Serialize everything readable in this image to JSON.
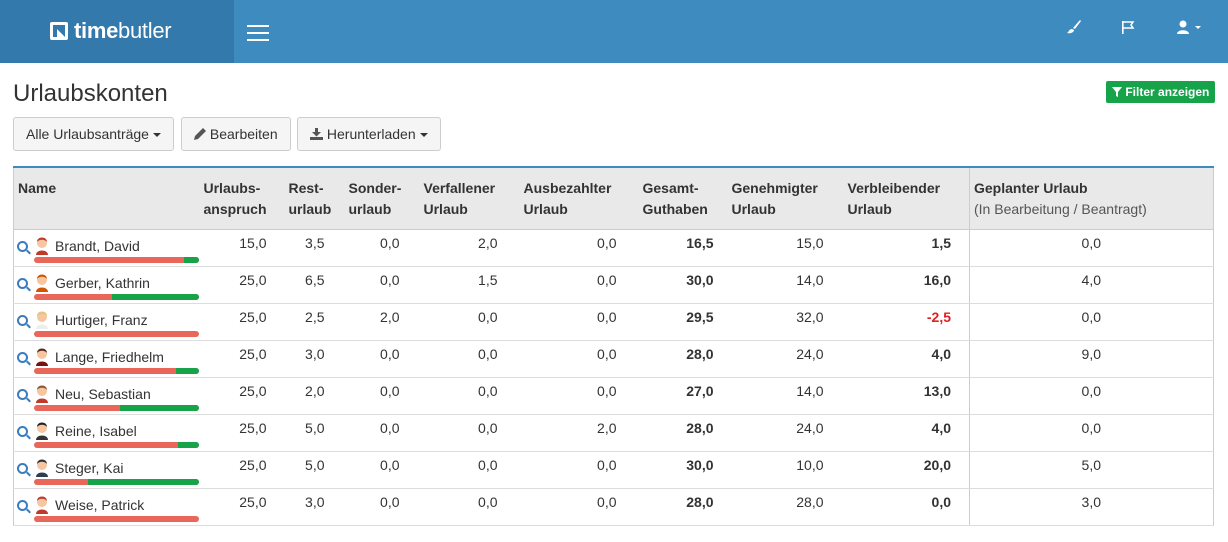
{
  "header": {
    "brand_bold": "time",
    "brand_rest": "butler"
  },
  "page": {
    "title": "Urlaubskonten",
    "filter_button": "Filter anzeigen"
  },
  "toolbar": {
    "requests": "Alle Urlaubsanträge",
    "edit": "Bearbeiten",
    "download": "Herunterladen"
  },
  "colors": {
    "navbar": "#3e8bc0",
    "brand": "#3379ac",
    "filter_button": "#17a34a",
    "bar_used": "#e8675a",
    "bar_remaining": "#17a34a",
    "negative": "#e02020"
  },
  "table": {
    "headers": [
      [
        "Name",
        ""
      ],
      [
        "Urlaubs-",
        "anspruch"
      ],
      [
        "Rest-",
        "urlaub"
      ],
      [
        "Sonder-",
        "urlaub"
      ],
      [
        "Verfallener",
        "Urlaub"
      ],
      [
        "Ausbezahlter",
        "Urlaub"
      ],
      [
        "Gesamt-",
        "Guthaben"
      ],
      [
        "Genehmigter",
        "Urlaub"
      ],
      [
        "Verbleibender",
        "Urlaub"
      ],
      [
        "Geplanter Urlaub",
        "(In Bearbeitung / Beantragt)"
      ]
    ],
    "rows": [
      {
        "name": "Brandt, David",
        "avatar": "person-male-redhair-icon",
        "values": [
          "15,0",
          "3,5",
          "0,0",
          "2,0",
          "0,0",
          "16,5",
          "15,0",
          "1,5",
          "0,0"
        ],
        "remaining_fraction": 0.09,
        "negative": false
      },
      {
        "name": "Gerber, Kathrin",
        "avatar": "person-female-redhair-icon",
        "values": [
          "25,0",
          "6,5",
          "0,0",
          "1,5",
          "0,0",
          "30,0",
          "14,0",
          "16,0",
          "4,0"
        ],
        "remaining_fraction": 0.53,
        "negative": false
      },
      {
        "name": "Hurtiger, Franz",
        "avatar": "person-male-blond-icon",
        "values": [
          "25,0",
          "2,5",
          "2,0",
          "0,0",
          "0,0",
          "29,5",
          "32,0",
          "-2,5",
          "0,0"
        ],
        "remaining_fraction": 0.0,
        "negative": true
      },
      {
        "name": "Lange, Friedhelm",
        "avatar": "person-male-darkhair-icon",
        "values": [
          "25,0",
          "3,0",
          "0,0",
          "0,0",
          "0,0",
          "28,0",
          "24,0",
          "4,0",
          "9,0"
        ],
        "remaining_fraction": 0.14,
        "negative": false
      },
      {
        "name": "Neu, Sebastian",
        "avatar": "person-male-brownhair-icon",
        "values": [
          "25,0",
          "2,0",
          "0,0",
          "0,0",
          "0,0",
          "27,0",
          "14,0",
          "13,0",
          "0,0"
        ],
        "remaining_fraction": 0.48,
        "negative": false
      },
      {
        "name": "Reine, Isabel",
        "avatar": "person-female-blackhair-icon",
        "values": [
          "25,0",
          "5,0",
          "0,0",
          "0,0",
          "2,0",
          "28,0",
          "24,0",
          "4,0",
          "0,0"
        ],
        "remaining_fraction": 0.13,
        "negative": false
      },
      {
        "name": "Steger, Kai",
        "avatar": "person-male-blackhair-icon",
        "values": [
          "25,0",
          "5,0",
          "0,0",
          "0,0",
          "0,0",
          "30,0",
          "10,0",
          "20,0",
          "5,0"
        ],
        "remaining_fraction": 0.67,
        "negative": false
      },
      {
        "name": "Weise, Patrick",
        "avatar": "person-male-redhair-icon",
        "values": [
          "25,0",
          "3,0",
          "0,0",
          "0,0",
          "0,0",
          "28,0",
          "28,0",
          "0,0",
          "3,0"
        ],
        "remaining_fraction": 0.0,
        "negative": false
      }
    ]
  }
}
